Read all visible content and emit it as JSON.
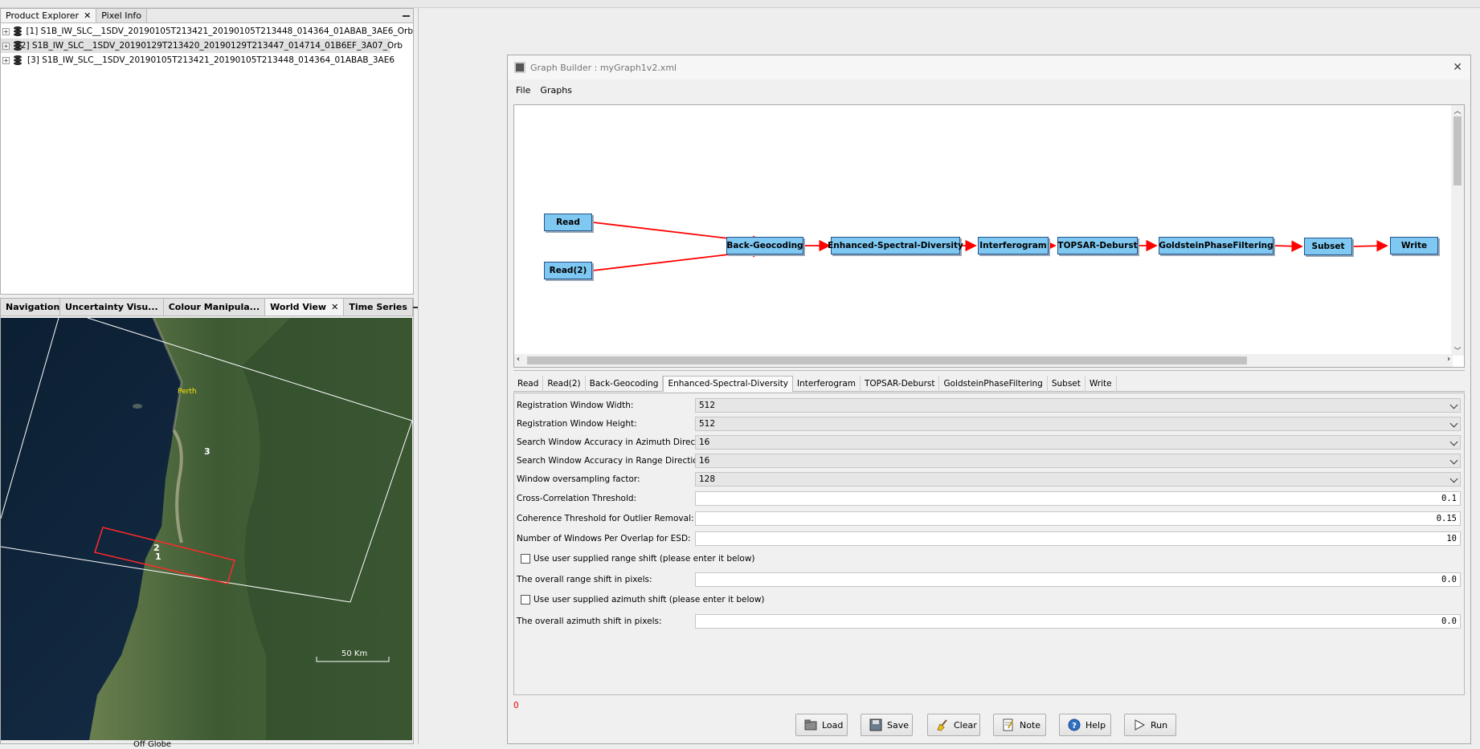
{
  "explorer": {
    "tabs": [
      {
        "label": "Product Explorer",
        "closable": true,
        "active": true
      },
      {
        "label": "Pixel Info",
        "closable": false,
        "active": false
      }
    ],
    "products": [
      {
        "label": "[1] S1B_IW_SLC__1SDV_20190105T213421_20190105T213448_014364_01ABAB_3AE6_Orb",
        "selected": false
      },
      {
        "label": "[2] S1B_IW_SLC__1SDV_20190129T213420_20190129T213447_014714_01B6EF_3A07_Orb",
        "selected": true
      },
      {
        "label": "[3] S1B_IW_SLC__1SDV_20190105T213421_20190105T213448_014364_01ABAB_3AE6",
        "selected": false
      }
    ]
  },
  "viewer": {
    "tabs": [
      {
        "label": "Navigation"
      },
      {
        "label": "Uncertainty Visu..."
      },
      {
        "label": "Colour Manipula..."
      },
      {
        "label": "World View",
        "closable": true,
        "active": true
      },
      {
        "label": "Time Series"
      }
    ],
    "city_label": "Perth",
    "footprint_labels": [
      "3",
      "2",
      "1"
    ],
    "scale_label": "50 Km",
    "status": "Off Globe"
  },
  "graph_builder": {
    "title": "Graph Builder : myGraph1v2.xml",
    "menu": [
      "File",
      "Graphs"
    ],
    "nodes": [
      "Read",
      "Read(2)",
      "Back-Geocoding",
      "Enhanced-Spectral-Diversity",
      "Interferogram",
      "TOPSAR-Deburst",
      "GoldsteinPhaseFiltering",
      "Subset",
      "Write"
    ],
    "param_tabs": [
      "Read",
      "Read(2)",
      "Back-Geocoding",
      "Enhanced-Spectral-Diversity",
      "Interferogram",
      "TOPSAR-Deburst",
      "GoldsteinPhaseFiltering",
      "Subset",
      "Write"
    ],
    "active_param_tab": "Enhanced-Spectral-Diversity",
    "params": {
      "reg_width": {
        "label": "Registration Window Width:",
        "value": "512"
      },
      "reg_height": {
        "label": "Registration Window Height:",
        "value": "512"
      },
      "search_az": {
        "label": "Search Window Accuracy in Azimuth Direction:",
        "value": "16"
      },
      "search_rg": {
        "label": "Search Window Accuracy in Range Direction:",
        "value": "16"
      },
      "oversampling": {
        "label": "Window oversampling factor:",
        "value": "128"
      },
      "xcorr": {
        "label": "Cross-Correlation Threshold:",
        "value": "0.1"
      },
      "coherence": {
        "label": "Coherence Threshold for Outlier Removal:",
        "value": "0.15"
      },
      "windows_per_overlap": {
        "label": "Number of Windows Per Overlap for ESD:",
        "value": "10"
      },
      "use_range_shift": {
        "label": "Use user supplied range shift (please enter it below)",
        "checked": false
      },
      "range_shift": {
        "label": "The overall range shift in pixels:",
        "value": "0.0"
      },
      "use_az_shift": {
        "label": "Use user supplied azimuth shift (please enter it below)",
        "checked": false
      },
      "az_shift": {
        "label": "The overall azimuth shift in pixels:",
        "value": "0.0"
      }
    },
    "status_counter": "0",
    "buttons": {
      "load": "Load",
      "save": "Save",
      "clear": "Clear",
      "note": "Note",
      "help": "Help",
      "run": "Run"
    }
  },
  "colors": {
    "node_fill": "#7fc8f2",
    "edge": "#ff0000",
    "footprint_highlight": "#ff2a2a"
  }
}
